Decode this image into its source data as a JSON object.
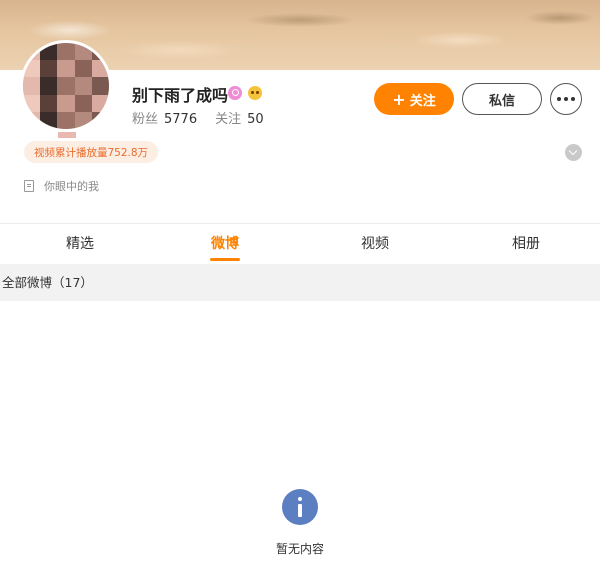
{
  "profile": {
    "name": "别下雨了成吗",
    "stats": {
      "fans_label": "粉丝",
      "fans_count": "5776",
      "following_label": "关注",
      "following_count": "50"
    },
    "video_play_tag": "视频累计播放量752.8万",
    "bio": "你眼中的我"
  },
  "actions": {
    "follow_plus": "+",
    "follow_label": "关注",
    "message_label": "私信"
  },
  "tabs": [
    {
      "label": "精选",
      "active": false
    },
    {
      "label": "微博",
      "active": true
    },
    {
      "label": "视频",
      "active": false
    },
    {
      "label": "相册",
      "active": false
    }
  ],
  "feed": {
    "section_title": "全部微博（17）",
    "empty_text": "暂无内容"
  },
  "colors": {
    "accent": "#ff8200",
    "empty_icon": "#5b7fc1",
    "tag_text": "#e86c2c"
  },
  "icons": [
    "avatar",
    "pink-badge-icon",
    "emoji-badge-icon",
    "more-icon",
    "expand-icon",
    "document-icon",
    "info-icon"
  ]
}
